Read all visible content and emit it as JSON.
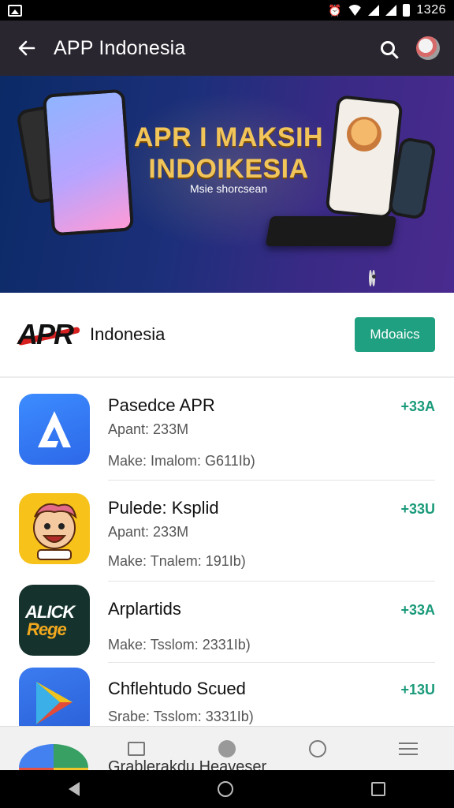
{
  "status_bar": {
    "time": "1326"
  },
  "app_bar": {
    "title": "APP Indonesia"
  },
  "banner": {
    "headline_line1": "APR I MAKSIH",
    "headline_line2": "INDOIKESIA",
    "subline": "Msie shorcsean"
  },
  "publisher": {
    "logo_text": "APR",
    "name": "Indonesia",
    "button_label": "Mdoaics"
  },
  "apps": [
    {
      "name": "Pasedce APR",
      "line1": "Apant: 233M",
      "line2": "Make: Imalom: G611Ib)",
      "delta": "+33A",
      "icon": "app-a-icon"
    },
    {
      "name": "Pulede: Ksplid",
      "line1": "Apant: 233M",
      "line2": "Make: Tnalem: 191Ib)",
      "delta": "+33U",
      "icon": "cartoon-face-icon"
    },
    {
      "name": "Arplartids",
      "line1": "",
      "line2": "Make: Tsslom: 2331Ib)",
      "delta": "+33A",
      "icon": "alick-logo-icon",
      "icon_text_top": "ALICK",
      "icon_text_bottom": "Rege"
    },
    {
      "name": "Chflehtudo Scued",
      "line1": "",
      "line2": "Srabe: Tsslom: 3331Ib)",
      "delta": "+13U",
      "icon": "play-store-icon"
    }
  ],
  "bottom_nav": {
    "peek_text": "Grablerakdu Heaveser"
  },
  "colors": {
    "accent": "#1fa080",
    "appbar": "#2a2630",
    "banner_gold": "#f2c55a",
    "delta_green": "#1a9a7a"
  }
}
